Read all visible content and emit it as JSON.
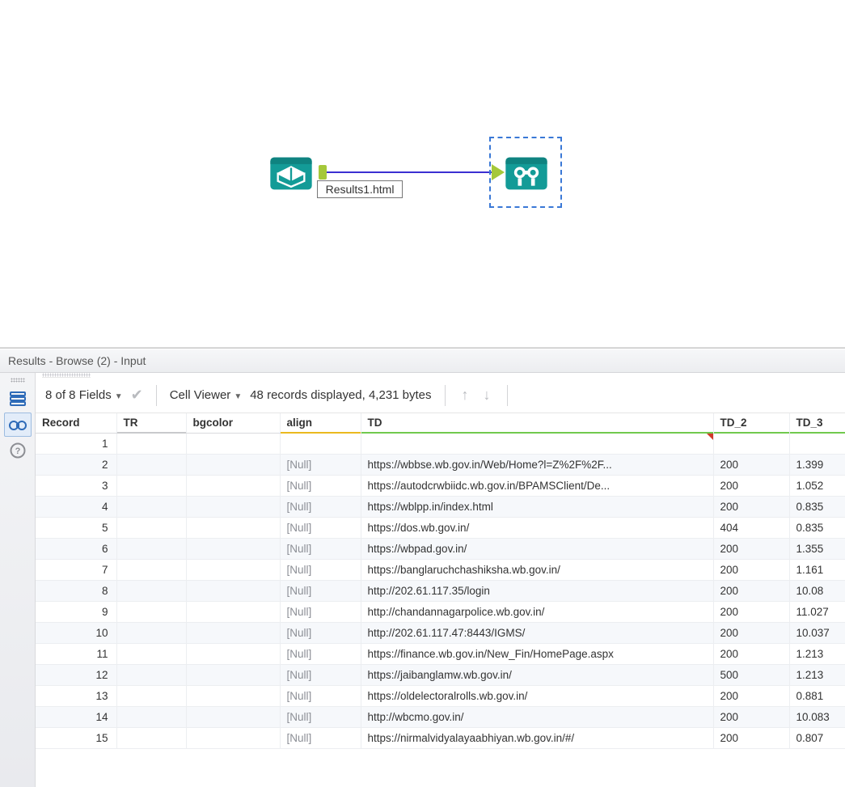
{
  "canvas": {
    "input_node_label": "Results1.html"
  },
  "results": {
    "title": "Results - Browse (2) - Input",
    "fields_label": "8 of 8 Fields",
    "cell_viewer_label": "Cell Viewer",
    "records_label": "48 records displayed, 4,231 bytes"
  },
  "grid": {
    "columns": [
      "Record",
      "TR",
      "bgcolor",
      "align",
      "TD",
      "TD_2",
      "TD_3"
    ],
    "rows": [
      {
        "n": "1",
        "tr": "",
        "bgcolor": "",
        "align": "",
        "td": "",
        "td2": "",
        "td3": ""
      },
      {
        "n": "2",
        "tr": "",
        "bgcolor": "",
        "align": "[Null]",
        "td": "https://wbbse.wb.gov.in/Web/Home?l=Z%2F%2F...",
        "td2": "200",
        "td3": "1.399"
      },
      {
        "n": "3",
        "tr": "",
        "bgcolor": "",
        "align": "[Null]",
        "td": "https://autodcrwbiidc.wb.gov.in/BPAMSClient/De...",
        "td2": "200",
        "td3": "1.052"
      },
      {
        "n": "4",
        "tr": "",
        "bgcolor": "",
        "align": "[Null]",
        "td": "https://wblpp.in/index.html",
        "td2": "200",
        "td3": "0.835"
      },
      {
        "n": "5",
        "tr": "",
        "bgcolor": "",
        "align": "[Null]",
        "td": "https://dos.wb.gov.in/",
        "td2": "404",
        "td3": "0.835"
      },
      {
        "n": "6",
        "tr": "",
        "bgcolor": "",
        "align": "[Null]",
        "td": "https://wbpad.gov.in/",
        "td2": "200",
        "td3": "1.355"
      },
      {
        "n": "7",
        "tr": "",
        "bgcolor": "",
        "align": "[Null]",
        "td": "https://banglaruchchashiksha.wb.gov.in/",
        "td2": "200",
        "td3": "1.161"
      },
      {
        "n": "8",
        "tr": "",
        "bgcolor": "",
        "align": "[Null]",
        "td": "http://202.61.117.35/login",
        "td2": "200",
        "td3": "10.08"
      },
      {
        "n": "9",
        "tr": "",
        "bgcolor": "",
        "align": "[Null]",
        "td": "http://chandannagarpolice.wb.gov.in/",
        "td2": "200",
        "td3": "11.027"
      },
      {
        "n": "10",
        "tr": "",
        "bgcolor": "",
        "align": "[Null]",
        "td": "http://202.61.117.47:8443/IGMS/",
        "td2": "200",
        "td3": "10.037"
      },
      {
        "n": "11",
        "tr": "",
        "bgcolor": "",
        "align": "[Null]",
        "td": "https://finance.wb.gov.in/New_Fin/HomePage.aspx",
        "td2": "200",
        "td3": "1.213"
      },
      {
        "n": "12",
        "tr": "",
        "bgcolor": "",
        "align": "[Null]",
        "td": "https://jaibanglamw.wb.gov.in/",
        "td2": "500",
        "td3": "1.213"
      },
      {
        "n": "13",
        "tr": "",
        "bgcolor": "",
        "align": "[Null]",
        "td": "https://oldelectoralrolls.wb.gov.in/",
        "td2": "200",
        "td3": "0.881"
      },
      {
        "n": "14",
        "tr": "",
        "bgcolor": "",
        "align": "[Null]",
        "td": "http://wbcmo.gov.in/",
        "td2": "200",
        "td3": "10.083"
      },
      {
        "n": "15",
        "tr": "",
        "bgcolor": "",
        "align": "[Null]",
        "td": "https://nirmalvidyalayaabhiyan.wb.gov.in/#/",
        "td2": "200",
        "td3": "0.807"
      }
    ]
  }
}
